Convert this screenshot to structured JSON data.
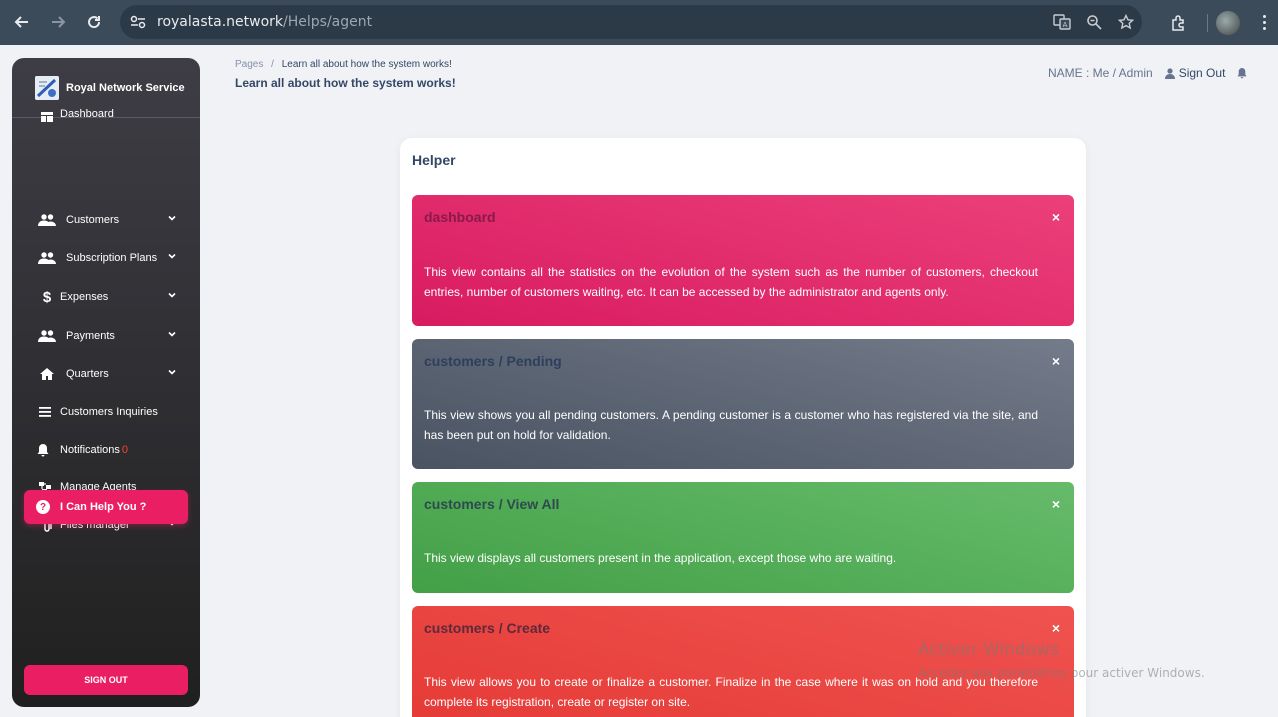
{
  "browser": {
    "url_host": "royalasta.network",
    "url_path": "/Helps/agent",
    "back_icon": "arrow-left-icon",
    "forward_icon": "arrow-right-icon",
    "reload_icon": "reload-icon"
  },
  "sidebar": {
    "brand": "Royal Network Service",
    "items": [
      {
        "label": "Dashboard",
        "icon": "dashboard-icon",
        "has_chevron": false
      },
      {
        "label": "Customers",
        "icon": "people-icon",
        "has_chevron": true
      },
      {
        "label": "Subscription Plans",
        "icon": "people-icon",
        "has_chevron": true
      },
      {
        "label": "Expenses",
        "icon": "dollar-icon",
        "has_chevron": true
      },
      {
        "label": "Payments",
        "icon": "people-icon",
        "has_chevron": true
      },
      {
        "label": "Quarters",
        "icon": "home-icon",
        "has_chevron": true
      },
      {
        "label": "Customers Inquiries",
        "icon": "list-icon",
        "has_chevron": false
      },
      {
        "label": "Notifications",
        "icon": "bell-icon",
        "has_chevron": false,
        "badge": "0"
      },
      {
        "label": "Manage Agents",
        "icon": "agents-icon",
        "has_chevron": false
      },
      {
        "label": "Files manager",
        "icon": "paperclip-icon",
        "has_chevron": true
      }
    ],
    "help_item": "I Can Help You ?",
    "signout": "SIGN OUT",
    "accent": "#e91e63"
  },
  "header": {
    "breadcrumb_root": "Pages",
    "breadcrumb_sep": "/",
    "breadcrumb_current": "Learn all about how the system works!",
    "title": "Learn all about how the system works!",
    "name_label": "NAME : Me / Admin",
    "signout": "Sign Out"
  },
  "helper": {
    "title": "Helper",
    "close_glyph": "×",
    "alerts": [
      {
        "title": "dashboard",
        "text": "This view contains all the statistics on the evolution of the system such as the number of customers, checkout entries, number of customers waiting, etc. It can be accessed by the administrator and agents only.",
        "color": "#e91e63"
      },
      {
        "title": "customers / Pending",
        "text": "This view shows you all pending customers. A pending customer is a customer who has registered via the site, and has been put on hold for validation.",
        "color": "#5f6676"
      },
      {
        "title": "customers / View All",
        "text": "This view displays all customers present in the application, except those who are waiting.",
        "color": "#4caf50"
      },
      {
        "title": "customers / Create",
        "text": "This view allows you to create or finalize a customer. Finalize in the case where it was on hold and you therefore complete its registration, create or register on site.",
        "color": "#e53935"
      }
    ]
  },
  "watermark": {
    "line1": "Activer Windows",
    "line2": "Accédez aux paramètres pour activer Windows."
  }
}
